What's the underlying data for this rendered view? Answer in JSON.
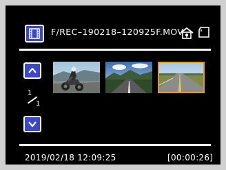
{
  "header": {
    "mode_icon": "video-mode-icon",
    "filename": "F/REC–190218–120925F.MOV",
    "protect_icon": "protect-lock-icon",
    "card_icon": "sd-card-icon"
  },
  "navigation": {
    "up_icon": "arrow-up-icon",
    "down_icon": "arrow-down-icon",
    "current_page": "1",
    "total_pages": "1"
  },
  "thumbnails": [
    {
      "name": "thumbnail-motorcycle",
      "selected": false
    },
    {
      "name": "thumbnail-road-mountains",
      "selected": false
    },
    {
      "name": "thumbnail-road-field",
      "selected": true
    }
  ],
  "footer": {
    "datetime": "2019/02/18 12:09:25",
    "duration": "[00:00:26]"
  },
  "colors": {
    "background": "#000000",
    "text": "#ffffff",
    "button_fill": "#3d48c8",
    "selection_border": "#e89a1a"
  }
}
